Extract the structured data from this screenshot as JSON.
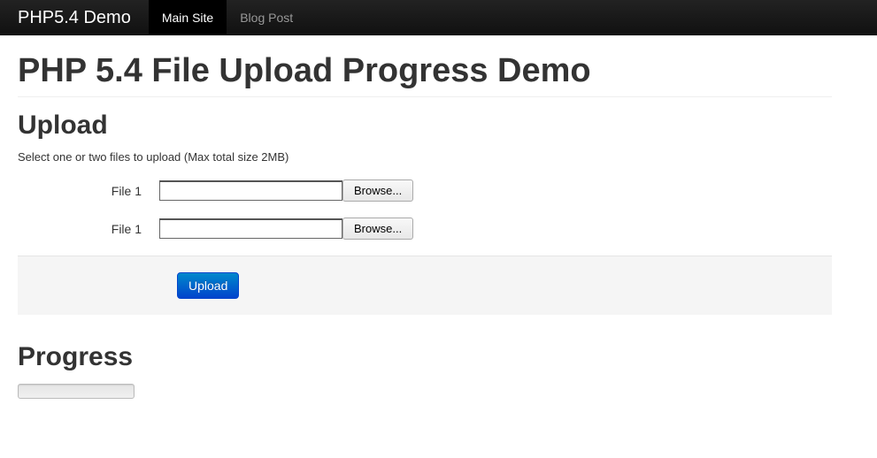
{
  "navbar": {
    "brand": "PHP5.4 Demo",
    "links": [
      {
        "label": "Main Site",
        "active": true
      },
      {
        "label": "Blog Post",
        "active": false
      }
    ]
  },
  "page": {
    "title": "PHP 5.4 File Upload Progress Demo"
  },
  "upload": {
    "heading": "Upload",
    "help": "Select one or two files to upload (Max total size 2MB)",
    "fields": [
      {
        "label": "File 1",
        "value": "",
        "browse": "Browse..."
      },
      {
        "label": "File 1",
        "value": "",
        "browse": "Browse..."
      }
    ],
    "submit": "Upload"
  },
  "progress": {
    "heading": "Progress",
    "value": 0
  }
}
